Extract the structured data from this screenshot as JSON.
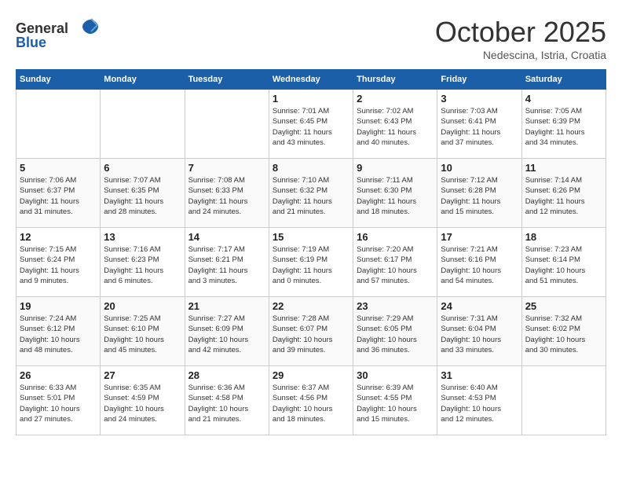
{
  "header": {
    "logo": {
      "general": "General",
      "blue": "Blue"
    },
    "title": "October 2025",
    "subtitle": "Nedescina, Istria, Croatia"
  },
  "calendar": {
    "days_of_week": [
      "Sunday",
      "Monday",
      "Tuesday",
      "Wednesday",
      "Thursday",
      "Friday",
      "Saturday"
    ],
    "weeks": [
      [
        {
          "day": "",
          "info": ""
        },
        {
          "day": "",
          "info": ""
        },
        {
          "day": "",
          "info": ""
        },
        {
          "day": "1",
          "info": "Sunrise: 7:01 AM\nSunset: 6:45 PM\nDaylight: 11 hours\nand 43 minutes."
        },
        {
          "day": "2",
          "info": "Sunrise: 7:02 AM\nSunset: 6:43 PM\nDaylight: 11 hours\nand 40 minutes."
        },
        {
          "day": "3",
          "info": "Sunrise: 7:03 AM\nSunset: 6:41 PM\nDaylight: 11 hours\nand 37 minutes."
        },
        {
          "day": "4",
          "info": "Sunrise: 7:05 AM\nSunset: 6:39 PM\nDaylight: 11 hours\nand 34 minutes."
        }
      ],
      [
        {
          "day": "5",
          "info": "Sunrise: 7:06 AM\nSunset: 6:37 PM\nDaylight: 11 hours\nand 31 minutes."
        },
        {
          "day": "6",
          "info": "Sunrise: 7:07 AM\nSunset: 6:35 PM\nDaylight: 11 hours\nand 28 minutes."
        },
        {
          "day": "7",
          "info": "Sunrise: 7:08 AM\nSunset: 6:33 PM\nDaylight: 11 hours\nand 24 minutes."
        },
        {
          "day": "8",
          "info": "Sunrise: 7:10 AM\nSunset: 6:32 PM\nDaylight: 11 hours\nand 21 minutes."
        },
        {
          "day": "9",
          "info": "Sunrise: 7:11 AM\nSunset: 6:30 PM\nDaylight: 11 hours\nand 18 minutes."
        },
        {
          "day": "10",
          "info": "Sunrise: 7:12 AM\nSunset: 6:28 PM\nDaylight: 11 hours\nand 15 minutes."
        },
        {
          "day": "11",
          "info": "Sunrise: 7:14 AM\nSunset: 6:26 PM\nDaylight: 11 hours\nand 12 minutes."
        }
      ],
      [
        {
          "day": "12",
          "info": "Sunrise: 7:15 AM\nSunset: 6:24 PM\nDaylight: 11 hours\nand 9 minutes."
        },
        {
          "day": "13",
          "info": "Sunrise: 7:16 AM\nSunset: 6:23 PM\nDaylight: 11 hours\nand 6 minutes."
        },
        {
          "day": "14",
          "info": "Sunrise: 7:17 AM\nSunset: 6:21 PM\nDaylight: 11 hours\nand 3 minutes."
        },
        {
          "day": "15",
          "info": "Sunrise: 7:19 AM\nSunset: 6:19 PM\nDaylight: 11 hours\nand 0 minutes."
        },
        {
          "day": "16",
          "info": "Sunrise: 7:20 AM\nSunset: 6:17 PM\nDaylight: 10 hours\nand 57 minutes."
        },
        {
          "day": "17",
          "info": "Sunrise: 7:21 AM\nSunset: 6:16 PM\nDaylight: 10 hours\nand 54 minutes."
        },
        {
          "day": "18",
          "info": "Sunrise: 7:23 AM\nSunset: 6:14 PM\nDaylight: 10 hours\nand 51 minutes."
        }
      ],
      [
        {
          "day": "19",
          "info": "Sunrise: 7:24 AM\nSunset: 6:12 PM\nDaylight: 10 hours\nand 48 minutes."
        },
        {
          "day": "20",
          "info": "Sunrise: 7:25 AM\nSunset: 6:10 PM\nDaylight: 10 hours\nand 45 minutes."
        },
        {
          "day": "21",
          "info": "Sunrise: 7:27 AM\nSunset: 6:09 PM\nDaylight: 10 hours\nand 42 minutes."
        },
        {
          "day": "22",
          "info": "Sunrise: 7:28 AM\nSunset: 6:07 PM\nDaylight: 10 hours\nand 39 minutes."
        },
        {
          "day": "23",
          "info": "Sunrise: 7:29 AM\nSunset: 6:05 PM\nDaylight: 10 hours\nand 36 minutes."
        },
        {
          "day": "24",
          "info": "Sunrise: 7:31 AM\nSunset: 6:04 PM\nDaylight: 10 hours\nand 33 minutes."
        },
        {
          "day": "25",
          "info": "Sunrise: 7:32 AM\nSunset: 6:02 PM\nDaylight: 10 hours\nand 30 minutes."
        }
      ],
      [
        {
          "day": "26",
          "info": "Sunrise: 6:33 AM\nSunset: 5:01 PM\nDaylight: 10 hours\nand 27 minutes."
        },
        {
          "day": "27",
          "info": "Sunrise: 6:35 AM\nSunset: 4:59 PM\nDaylight: 10 hours\nand 24 minutes."
        },
        {
          "day": "28",
          "info": "Sunrise: 6:36 AM\nSunset: 4:58 PM\nDaylight: 10 hours\nand 21 minutes."
        },
        {
          "day": "29",
          "info": "Sunrise: 6:37 AM\nSunset: 4:56 PM\nDaylight: 10 hours\nand 18 minutes."
        },
        {
          "day": "30",
          "info": "Sunrise: 6:39 AM\nSunset: 4:55 PM\nDaylight: 10 hours\nand 15 minutes."
        },
        {
          "day": "31",
          "info": "Sunrise: 6:40 AM\nSunset: 4:53 PM\nDaylight: 10 hours\nand 12 minutes."
        },
        {
          "day": "",
          "info": ""
        }
      ]
    ]
  }
}
